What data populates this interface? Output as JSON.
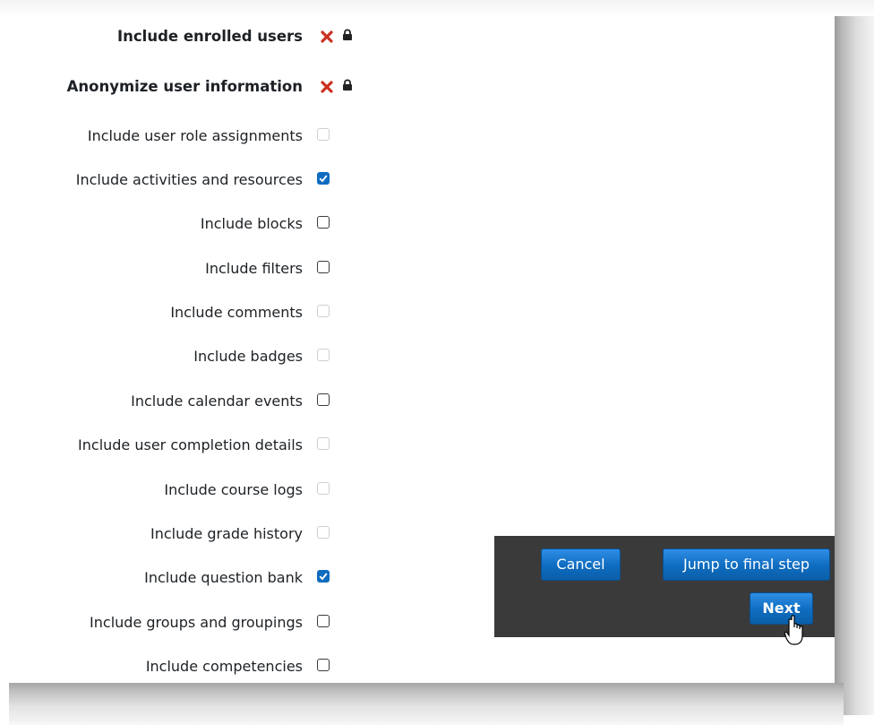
{
  "settings": [
    {
      "label": "Include enrolled users",
      "state": "locked-off",
      "bold": true
    },
    {
      "label": "Anonymize user information",
      "state": "locked-off",
      "bold": true
    },
    {
      "label": "Include user role assignments",
      "state": "disabled"
    },
    {
      "label": "Include activities and resources",
      "state": "checked"
    },
    {
      "label": "Include blocks",
      "state": "unchecked"
    },
    {
      "label": "Include filters",
      "state": "unchecked"
    },
    {
      "label": "Include comments",
      "state": "disabled"
    },
    {
      "label": "Include badges",
      "state": "disabled"
    },
    {
      "label": "Include calendar events",
      "state": "unchecked"
    },
    {
      "label": "Include user completion details",
      "state": "disabled"
    },
    {
      "label": "Include course logs",
      "state": "disabled"
    },
    {
      "label": "Include grade history",
      "state": "disabled"
    },
    {
      "label": "Include question bank",
      "state": "checked"
    },
    {
      "label": "Include groups and groupings",
      "state": "unchecked"
    },
    {
      "label": "Include competencies",
      "state": "unchecked"
    }
  ],
  "buttons": {
    "cancel": "Cancel",
    "jump": "Jump to final step",
    "next": "Next"
  },
  "icons": {
    "locked_off": "cross-icon",
    "lock": "lock-icon",
    "cursor": "hand-pointer-icon"
  },
  "colors": {
    "accent": "#0f6cbf",
    "cross": "#ca3120",
    "toolbar_bg": "#3a3a3a"
  }
}
